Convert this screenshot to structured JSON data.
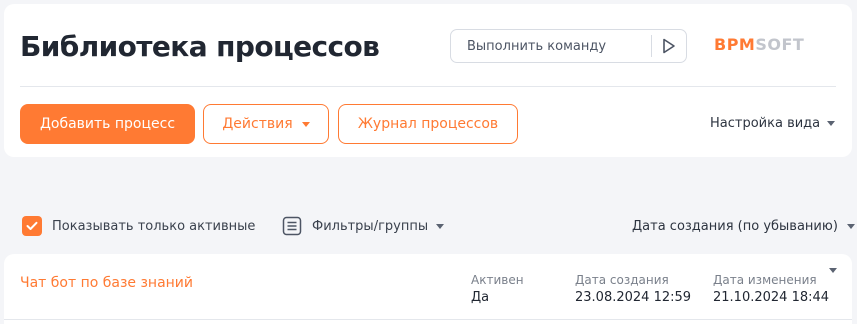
{
  "header": {
    "title": "Библиотека процессов",
    "command": {
      "placeholder": "Выполнить команду",
      "run_icon": "play-icon"
    },
    "logo": {
      "bpm": "BPM",
      "soft": "SOFT"
    },
    "buttons": {
      "add_process": "Добавить процесс",
      "actions": "Действия",
      "journal": "Журнал процессов"
    },
    "view_settings": "Настройка вида"
  },
  "toolbar": {
    "show_active_only": {
      "label": "Показывать только активные",
      "checked": true
    },
    "filters": {
      "label": "Фильтры/группы",
      "icon": "filter-list-icon"
    },
    "sort": {
      "label": "Дата создания (по убыванию)"
    }
  },
  "list": {
    "rows": [
      {
        "name": "Чат бот по базе знаний",
        "active_label": "Активен",
        "active_value": "Да",
        "created_label": "Дата создания",
        "created_value": "23.08.2024 12:59",
        "modified_label": "Дата изменения",
        "modified_value": "21.10.2024 18:44"
      }
    ]
  },
  "colors": {
    "accent": "#ff7a33",
    "background": "#f4f5f8",
    "card": "#ffffff",
    "text": "#212732",
    "muted": "#7a808b"
  }
}
